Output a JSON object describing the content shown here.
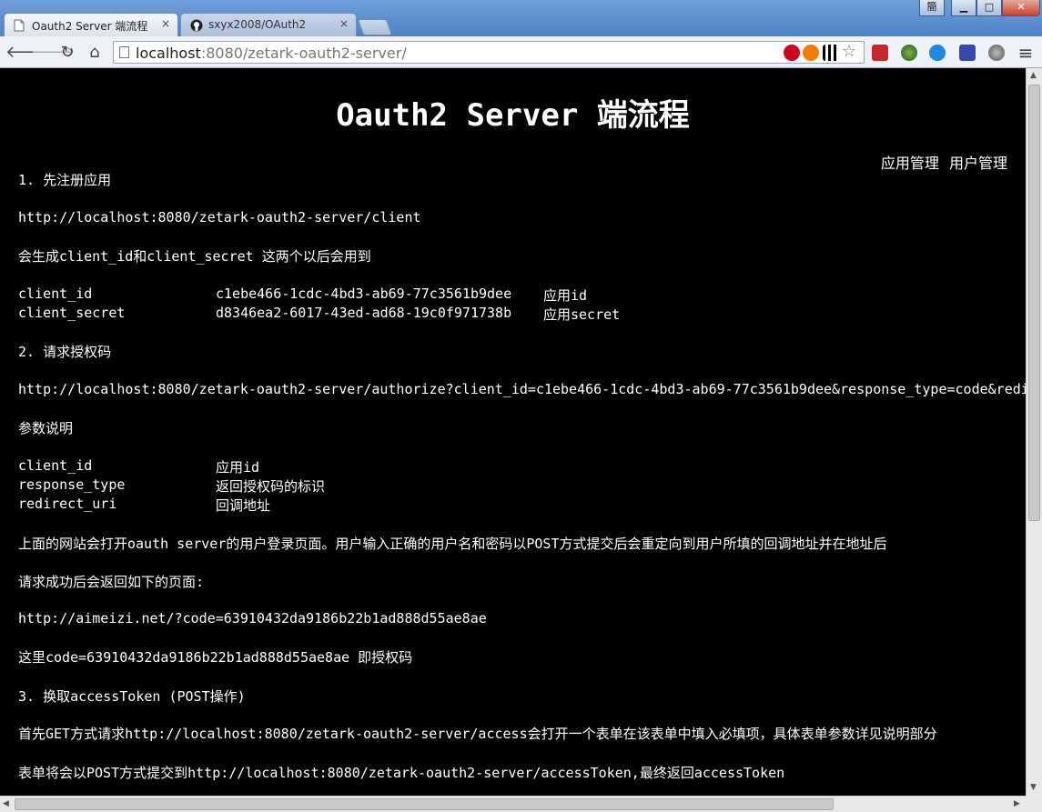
{
  "tabs": [
    {
      "label": "Oauth2 Server 端流程",
      "close": "×"
    },
    {
      "label": "sxyx2008/OAuth2",
      "close": "×"
    }
  ],
  "window": {
    "ime": "簡",
    "minimize": "▁",
    "maximize": "□",
    "close": "✕"
  },
  "toolbar": {
    "back": "🡐",
    "forward": "🡒",
    "reload": "↻",
    "home": "⌂",
    "url_host": "localhost",
    "url_rest": ":8080/zetark-oauth2-server/",
    "star": "☆",
    "menu": "≡"
  },
  "page": {
    "title": "Oauth2 Server 端流程",
    "nav": [
      "应用管理",
      "用户管理"
    ],
    "s1_heading": "1. 先注册应用",
    "s1_url": "http://localhost:8080/zetark-oauth2-server/client",
    "s1_desc": "会生成client_id和client_secret 这两个以后会用到",
    "s1_rows": [
      {
        "key": "client_id",
        "value": "c1ebe466-1cdc-4bd3-ab69-77c3561b9dee",
        "desc": "应用id"
      },
      {
        "key": "client_secret",
        "value": "d8346ea2-6017-43ed-ad68-19c0f971738b",
        "desc": "应用secret"
      }
    ],
    "s2_heading": "2. 请求授权码",
    "s2_url": "http://localhost:8080/zetark-oauth2-server/authorize?client_id=c1ebe466-1cdc-4bd3-ab69-77c3561b9dee&response_type=code&redi",
    "s2_params_title": "参数说明",
    "s2_params": [
      {
        "key": "client_id",
        "desc": "应用id"
      },
      {
        "key": "response_type",
        "desc": "返回授权码的标识"
      },
      {
        "key": "redirect_uri",
        "desc": "回调地址"
      }
    ],
    "s2_desc": "上面的网站会打开oauth server的用户登录页面。用户输入正确的用户名和密码以POST方式提交后会重定向到用户所填的回调地址并在地址后",
    "s2_success": "请求成功后会返回如下的页面:",
    "s2_return_url": "http://aimeizi.net/?code=63910432da9186b22b1ad888d55ae8ae",
    "s2_code_note": "这里code=63910432da9186b22b1ad888d55ae8ae 即授权码",
    "s3_heading": "3. 换取accessToken (POST操作)",
    "s3_line1": "首先GET方式请求http://localhost:8080/zetark-oauth2-server/access会打开一个表单在该表单中填入必填项，具体表单参数详见说明部分",
    "s3_line2": "表单将会以POST方式提交到http://localhost:8080/zetark-oauth2-server/accessToken,最终返回accessToken"
  },
  "colors": {
    "background": "#000000",
    "text": "#ffffff",
    "titlebar": "#5b8dcc"
  }
}
